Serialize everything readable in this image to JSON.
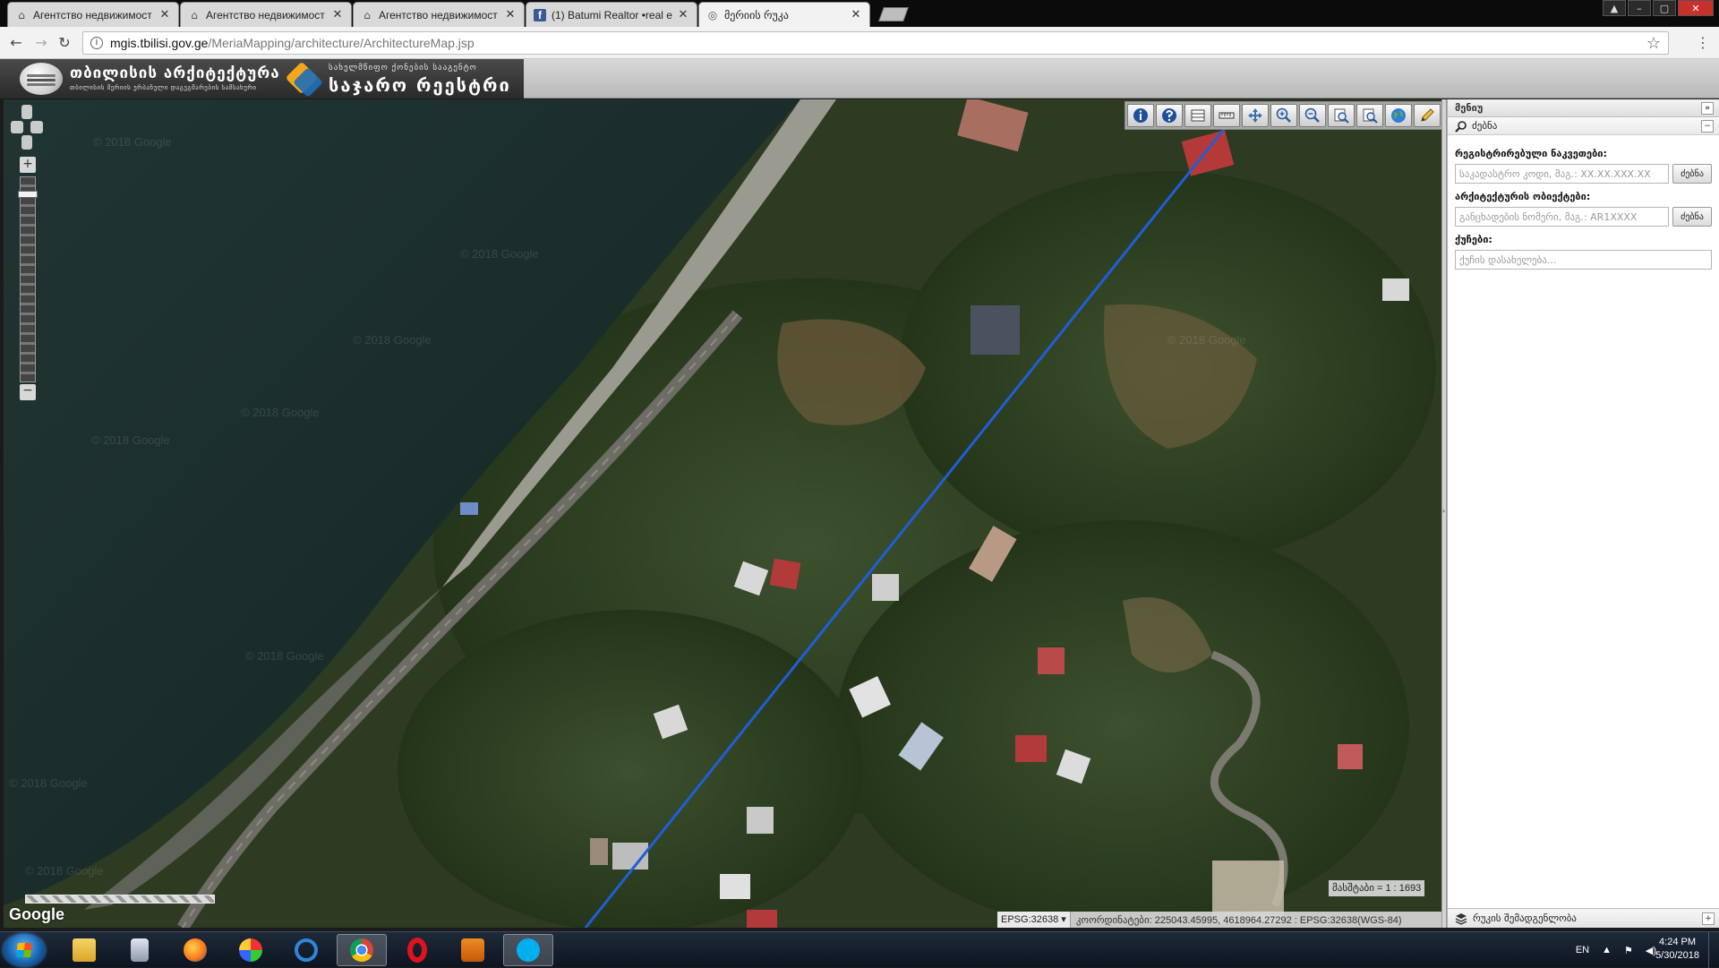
{
  "browser": {
    "tabs": [
      {
        "title": "Агентство недвижимост",
        "icon": "globe-icon",
        "active": false
      },
      {
        "title": "Агентство недвижимост",
        "icon": "globe-icon",
        "active": false
      },
      {
        "title": "Агентство недвижимост",
        "icon": "globe-icon",
        "active": false
      },
      {
        "title": "(1) Batumi Realtor •real e",
        "icon": "facebook-icon",
        "active": false
      },
      {
        "title": "მერიის რუკა",
        "icon": "globe-icon",
        "active": true
      }
    ],
    "tab_close_glyph": "✕",
    "url_host": "mgis.tbilisi.gov.ge",
    "url_path": "/MeriaMapping/architecture/ArchitectureMap.jsp"
  },
  "site": {
    "logo1_title": "თბილისის არქიტექტურა",
    "logo1_subtitle": "თბილისის მერიის ურბანული დაგეგმარების სამსახური",
    "logo2_title_small": "სახელმწიფო ქონების სააგენტო",
    "logo2_title_big": "საჯარო რეესტრი"
  },
  "map": {
    "watermark": "© 2018 Google",
    "google_logo": "Google",
    "scale_label": "მასშტაბი = 1 : 1693",
    "projection": "EPSG:32638",
    "coordinates_text": "კოორდინატები: 225043.45995, 4618964.27292 : EPSG:32638(WGS-84)",
    "tools": [
      "info-icon",
      "help-icon",
      "layers-icon",
      "measure-icon",
      "pan-icon",
      "zoom-in-icon",
      "zoom-out-icon",
      "zoom-prev-icon",
      "zoom-next-icon",
      "globe-icon",
      "pencil-icon"
    ]
  },
  "panel": {
    "title": "მენიუ",
    "search_section": "ძებნა",
    "label_cadastral": "რეგისტრირებული ნაკვეთები:",
    "placeholder_cadastral": "საკადასტრო კოდი, მაგ.: XX.XX.XXX.XX",
    "label_architecture": "არქიტექტურის ობიექტები:",
    "placeholder_architecture": "განცხადების ნომერი, მაგ.: AR1XXXX",
    "label_street": "ქუჩები:",
    "placeholder_street": "ქუჩის დასახელება...",
    "search_button": "ძებნა",
    "footer_label": "რუკის შემადგენლობა"
  },
  "taskbar": {
    "language": "EN",
    "time": "4:24 PM",
    "date": "5/30/2018"
  },
  "colors": {
    "route_line": "#1f5fd6",
    "sea": "#1a2e2c",
    "vegetation": "#2b3a20"
  }
}
